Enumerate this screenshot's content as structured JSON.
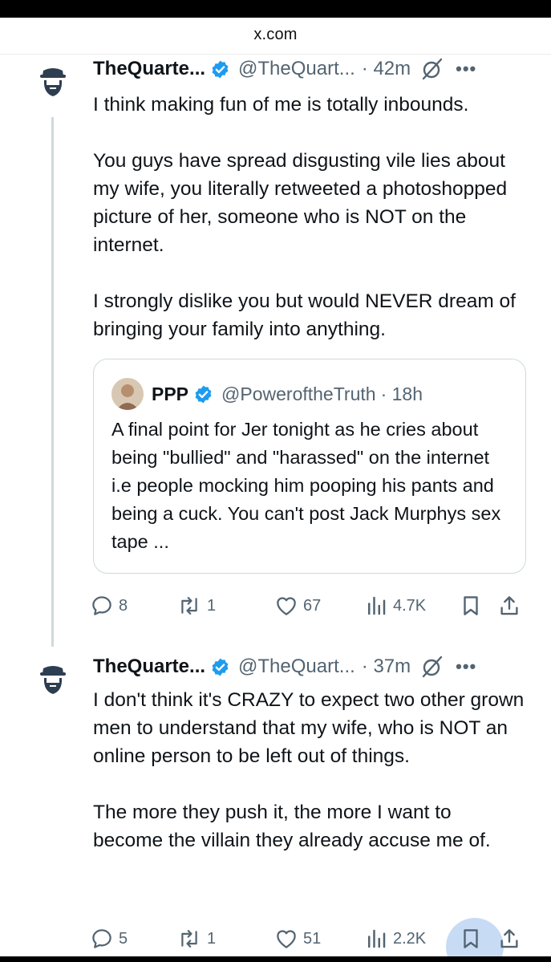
{
  "browser": {
    "url": "x.com"
  },
  "tweets": [
    {
      "name": "TheQuarte...",
      "handle": "@TheQuart...",
      "time": "· 42m",
      "paragraphs": [
        "I think making fun of me is totally inbounds.",
        "You guys have spread disgusting vile lies about my wife, you literally retweeted a photoshopped picture of her, someone who is NOT on the internet.",
        "I strongly dislike you but would NEVER dream of bringing your family into anything."
      ],
      "quote": {
        "name": "PPP",
        "handle": "@PoweroftheTruth",
        "time": "· 18h",
        "text": "A final point for Jer tonight as he cries about being \"bullied\" and \"harassed\" on the internet i.e people mocking him pooping his pants and being a cuck. You can't post Jack Murphys sex tape ..."
      },
      "stats": {
        "replies": "8",
        "reposts": "1",
        "likes": "67",
        "views": "4.7K"
      }
    },
    {
      "name": "TheQuarte...",
      "handle": "@TheQuart...",
      "time": "· 37m",
      "paragraphs": [
        "I don't think it's CRAZY to expect two other grown men to understand that my wife, who is NOT an online person to be left out of things.",
        "The more they push it, the more I want to become the villain they already accuse me of."
      ],
      "stats": {
        "replies": "5",
        "reposts": "1",
        "likes": "51",
        "views": "2.2K"
      }
    }
  ],
  "icons": {
    "verified": "verified-badge-icon",
    "grok": "grok-icon",
    "more": "more-icon",
    "reply": "reply-icon",
    "repost": "repost-icon",
    "like": "heart-icon",
    "views": "views-icon",
    "bookmark": "bookmark-icon",
    "share": "share-icon"
  },
  "colors": {
    "verified": "#1d9bf0",
    "muted": "#536471",
    "text": "#0f1419",
    "border": "#cfd9de"
  }
}
